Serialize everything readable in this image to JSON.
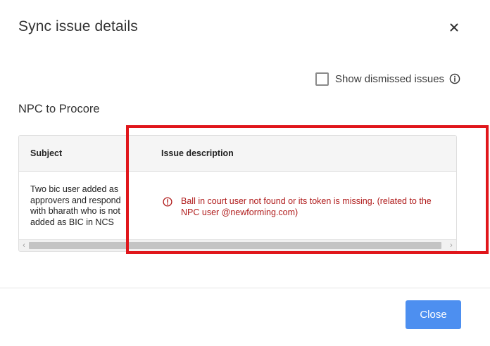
{
  "dialog": {
    "title": "Sync issue details",
    "close_icon": "close-icon"
  },
  "filters": {
    "show_dismissed_label": "Show dismissed issues",
    "show_dismissed_checked": false,
    "info_icon": "info-icon"
  },
  "section": {
    "title": "NPC to Procore"
  },
  "table": {
    "columns": [
      "Subject",
      "Issue description"
    ],
    "rows": [
      {
        "subject": "Two bic user added as approvers and respond with bharath who is not added as BIC in NCS",
        "description": "Ball in court user not found or its token is missing. (related to the NPC user @newforming.com)",
        "icon": "error-circle-icon"
      }
    ]
  },
  "colors": {
    "error_text": "#b01c1c",
    "primary_button": "#4d8ff0",
    "annotation_outline": "#e0161b"
  },
  "footer": {
    "close_label": "Close"
  }
}
